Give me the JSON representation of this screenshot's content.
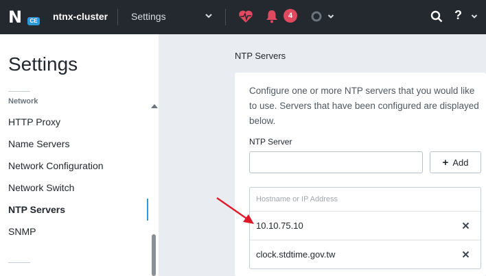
{
  "topbar": {
    "logo_mark": "N",
    "logo_badge": "CE",
    "cluster_name": "ntnx-cluster",
    "section": "Settings",
    "alert_count": "4",
    "help_label": "?",
    "icons": [
      "chevron-down-icon",
      "heart-icon",
      "bell-icon",
      "status-circle-icon",
      "search-icon",
      "help-icon"
    ]
  },
  "sidebar": {
    "title": "Settings",
    "group_label": "Network",
    "items": [
      {
        "label": "HTTP Proxy"
      },
      {
        "label": "Name Servers"
      },
      {
        "label": "Network Configuration"
      },
      {
        "label": "Network Switch"
      },
      {
        "label": "NTP Servers",
        "active": true
      },
      {
        "label": "SNMP"
      }
    ]
  },
  "main": {
    "title": "NTP Servers",
    "description": "Configure one or more NTP servers that you would like to use. Servers that have been configured are displayed below.",
    "field_label": "NTP Server",
    "input_value": "",
    "add_label": "Add",
    "list_header": "Hostname or IP Address",
    "servers": [
      "10.10.75.10",
      "clock.stdtime.gov.tw"
    ]
  },
  "colors": {
    "topbar": "#24292f",
    "accent": "#2d9ad6",
    "alert": "#e04a5f",
    "annotation_arrow": "#e0192a"
  }
}
